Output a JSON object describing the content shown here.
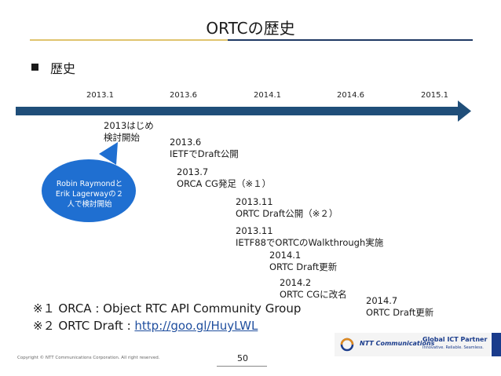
{
  "slide": {
    "title": "ORTCの歴史",
    "heading": "歴史"
  },
  "timeline": {
    "ticks": [
      "2013.1",
      "2013.6",
      "2014.1",
      "2014.6",
      "2015.1"
    ],
    "events": [
      {
        "line1": "2013はじめ",
        "line2": "検討開始"
      },
      {
        "line1": "2013.6",
        "line2": "IETFでDraft公開"
      },
      {
        "line1": "2013.7",
        "line2": "ORCA CG発足（※１）"
      },
      {
        "line1": "2013.11",
        "line2": "ORTC Draft公開（※２）"
      },
      {
        "line1": "2013.11",
        "line2": "IETF88でORTCのWalkthrough実施"
      },
      {
        "line1": "2014.1",
        "line2": "ORTC Draft更新"
      },
      {
        "line1": "2014.2",
        "line2": "ORTC CGに改名"
      },
      {
        "line1": "2014.7",
        "line2": "ORTC Draft更新"
      }
    ]
  },
  "bubble": {
    "line1": "Robin Raymondと",
    "line2": "Erik Lagerwayの２",
    "line3": "人で検討開始"
  },
  "notes": {
    "note1": "※１ ORCA : Object RTC API Community Group",
    "note2_prefix": "※２ ORTC Draft : ",
    "note2_link": "http://goo.gl/HuyLWL"
  },
  "footer": {
    "copyright": "Copyright © NTT Communications Corporation. All right reserved.",
    "page": "50",
    "logo_name": "NTT Communications",
    "partner": "Global ICT Partner",
    "partner_sub": "Innovative. Reliable. Seamless."
  },
  "colors": {
    "arrow": "#1f4e79",
    "bubble": "#1f6fd1",
    "gold_rule": "#e0c46e",
    "navy_rule": "#1f3864"
  }
}
